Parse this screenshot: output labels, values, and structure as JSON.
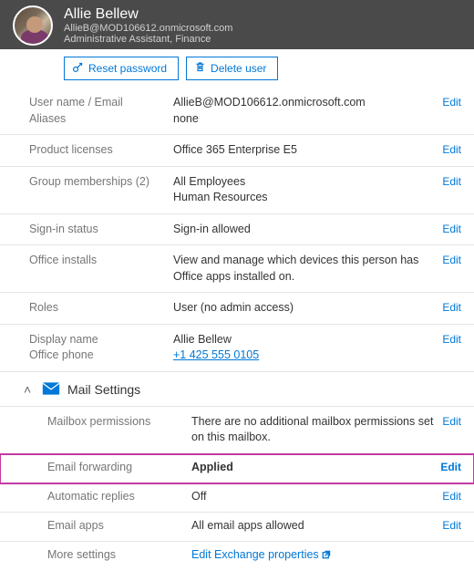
{
  "header": {
    "name": "Allie Bellew",
    "email": "AllieB@MOD106612.onmicrosoft.com",
    "jobTitle": "Administrative Assistant, Finance"
  },
  "actions": {
    "reset": "Reset password",
    "delete": "Delete user"
  },
  "fields": {
    "username_label": "User name / Email",
    "username_value": "AllieB@MOD106612.onmicrosoft.com",
    "aliases_label": "Aliases",
    "aliases_value": "none",
    "licenses_label": "Product licenses",
    "licenses_value": "Office 365 Enterprise E5",
    "groups_label": "Group memberships (2)",
    "groups_value1": "All Employees",
    "groups_value2": "Human Resources",
    "signin_label": "Sign-in status",
    "signin_value": "Sign-in allowed",
    "installs_label": "Office installs",
    "installs_value": "View and manage which devices this person has Office apps installed on.",
    "roles_label": "Roles",
    "roles_value": "User (no admin access)",
    "display_label": "Display name",
    "display_value": "Allie Bellew",
    "phone_label": "Office phone",
    "phone_value": "+1 425 555 0105"
  },
  "mail": {
    "section_title": "Mail Settings",
    "permissions_label": "Mailbox permissions",
    "permissions_value": "There are no additional mailbox permissions set on this mailbox.",
    "forwarding_label": "Email forwarding",
    "forwarding_value": "Applied",
    "autoreplies_label": "Automatic replies",
    "autoreplies_value": "Off",
    "emailapps_label": "Email apps",
    "emailapps_value": "All email apps allowed",
    "more_label": "More settings",
    "more_link": "Edit Exchange properties"
  },
  "ui": {
    "edit": "Edit"
  }
}
